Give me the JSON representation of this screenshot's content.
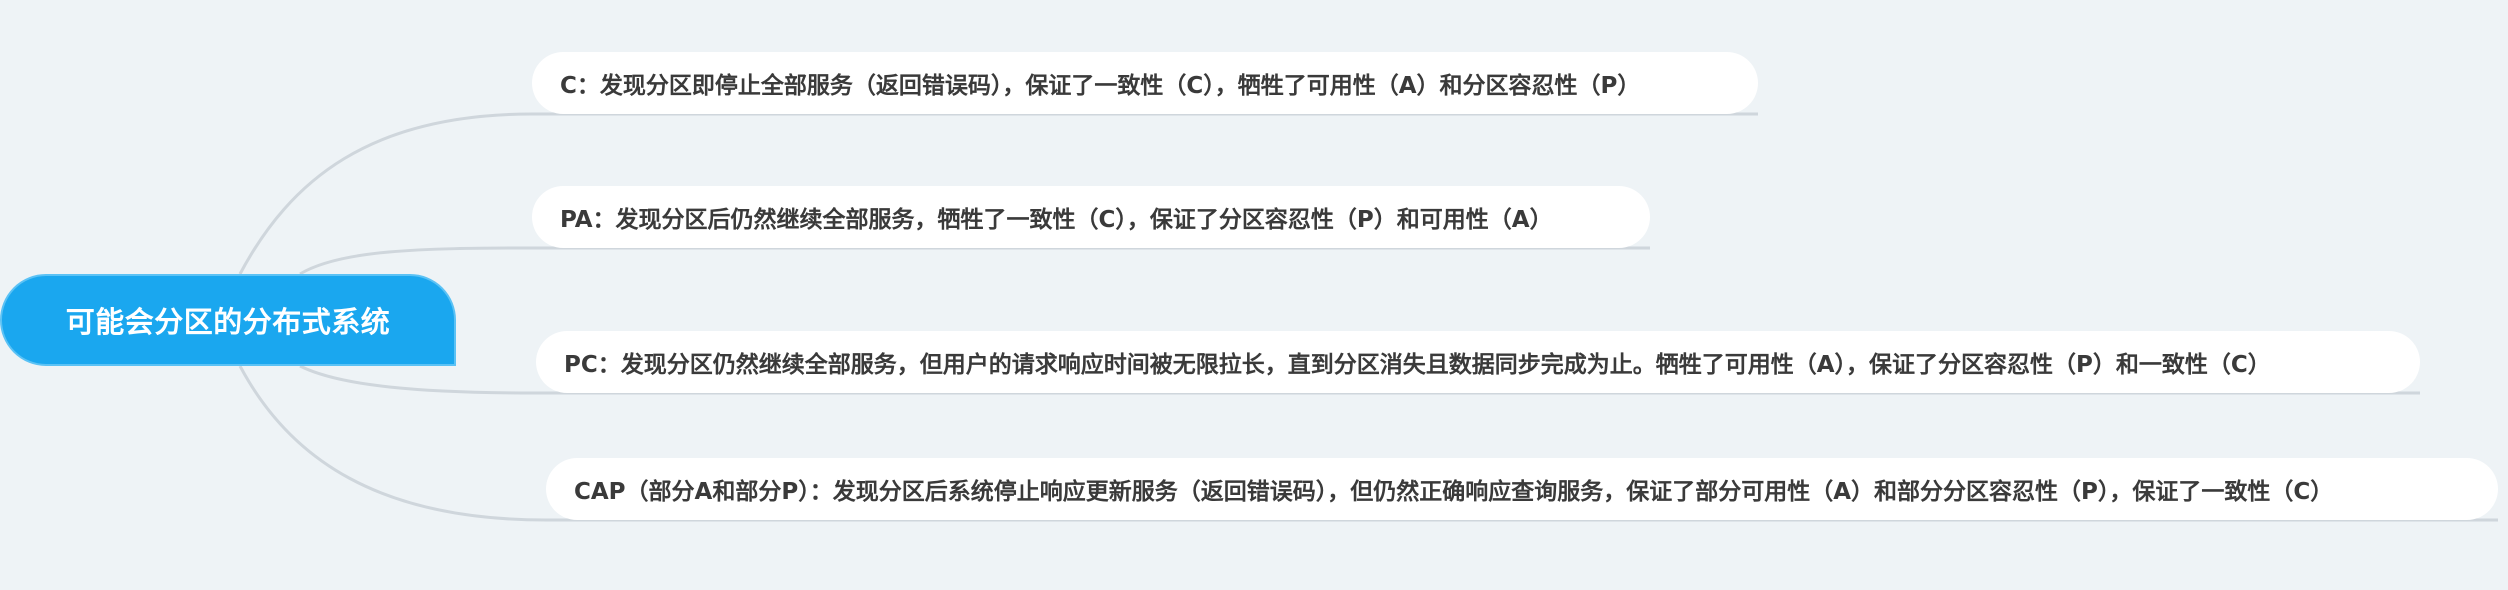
{
  "mindmap": {
    "central_topic": "可能会分区的分布式系统",
    "branches": [
      "C：发现分区即停止全部服务（返回错误码），保证了一致性（C），牺牲了可用性（A）和分区容忍性（P）",
      "PA：发现分区后仍然继续全部服务，牺牲了一致性（C），保证了分区容忍性（P）和可用性（A）",
      "PC：发现分区仍然继续全部服务，但用户的请求响应时间被无限拉长，直到分区消失且数据同步完成为止。牺牲了可用性（A），保证了分区容忍性（P）和一致性（C）",
      "CAP（部分A和部分P）：发现分区后系统停止响应更新服务（返回错误码），但仍然正确响应查询服务，保证了部分可用性（A）和部分分区容忍性（P），保证了一致性（C）"
    ]
  },
  "colors": {
    "background": "#eef3f6",
    "root_fill": "#1aa7ef",
    "root_text": "#ffffff",
    "branch_fill": "#ffffff",
    "branch_text": "#3a3a3a",
    "connector": "#cfd6dc"
  }
}
